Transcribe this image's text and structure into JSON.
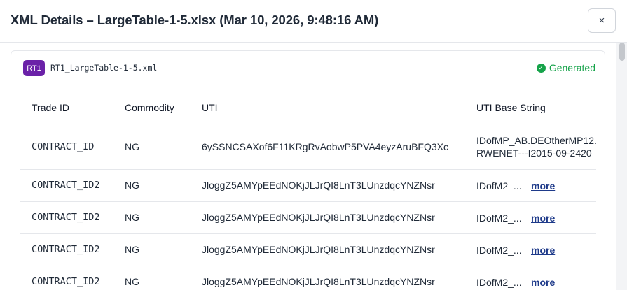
{
  "modal": {
    "title": "XML Details – LargeTable-1-5.xlsx (Mar 10, 2026, 9:48:16 AM)",
    "close_label": "×"
  },
  "file": {
    "badge": "RT1",
    "name": "RT1_LargeTable-1-5.xml",
    "status": "Generated",
    "status_color": "#16a34a",
    "badge_color": "#6b21a8"
  },
  "table": {
    "headers": [
      "Trade ID",
      "Commodity",
      "UTI",
      "UTI Base String"
    ],
    "more_label": "more",
    "rows": [
      {
        "trade_id": "CONTRACT_ID",
        "commodity": "NG",
        "uti": "6ySSNCSAXof6F11KRgRvAobwP5PVA4eyzAruBFQ3Xc",
        "uti_base_line1": "IDofMP_AB.DEOtherMP12.",
        "uti_base_line2": "RWENET---I2015-09-2420"
      },
      {
        "trade_id": "CONTRACT_ID2",
        "commodity": "NG",
        "uti": "JloggZ5AMYpEEdNOKjJLJrQI8LnT3LUnzdqcYNZNsr",
        "uti_base": "IDofM2_..."
      },
      {
        "trade_id": "CONTRACT_ID2",
        "commodity": "NG",
        "uti": "JloggZ5AMYpEEdNOKjJLJrQI8LnT3LUnzdqcYNZNsr",
        "uti_base": "IDofM2_..."
      },
      {
        "trade_id": "CONTRACT_ID2",
        "commodity": "NG",
        "uti": "JloggZ5AMYpEEdNOKjJLJrQI8LnT3LUnzdqcYNZNsr",
        "uti_base": "IDofM2_..."
      },
      {
        "trade_id": "CONTRACT_ID2",
        "commodity": "NG",
        "uti": "JloggZ5AMYpEEdNOKjJLJrQI8LnT3LUnzdqcYNZNsr",
        "uti_base": "IDofM2_..."
      }
    ]
  }
}
